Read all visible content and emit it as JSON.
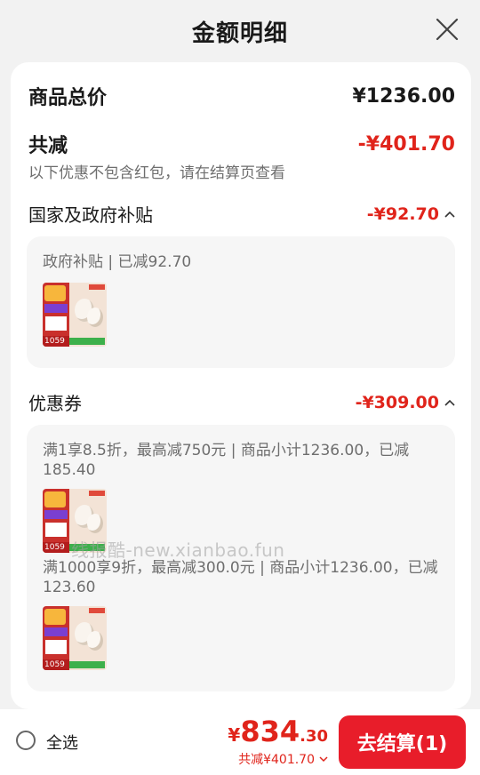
{
  "header": {
    "title": "金额明细"
  },
  "summary": {
    "goods_total_label": "商品总价",
    "goods_total_value": "¥1236.00",
    "discount_label": "共减",
    "discount_value": "-¥401.70",
    "note": "以下优惠不包含红包，请在结算页查看"
  },
  "subsidy": {
    "label": "国家及政府补贴",
    "value": "-¥92.70",
    "detail": "政府补贴 | 已减92.70",
    "thumb_price": "1059"
  },
  "coupons": {
    "label": "优惠券",
    "value": "-¥309.00",
    "items": [
      {
        "text": "满1享8.5折，最高减750元 | 商品小计1236.00，已减185.40",
        "thumb_price": "1059"
      },
      {
        "text": "满1000享9折，最高减300.0元 | 商品小计1236.00，已减123.60",
        "thumb_price": "1059"
      }
    ]
  },
  "watermark": "线报酷-new.xianbao.fun",
  "bottom": {
    "select_all": "全选",
    "currency": "¥",
    "price_int": "834",
    "price_dec": ".30",
    "saved": "共减¥401.70",
    "checkout": "去结算(1)"
  },
  "colors": {
    "accent": "#e0241b",
    "button": "#e81d2a"
  }
}
